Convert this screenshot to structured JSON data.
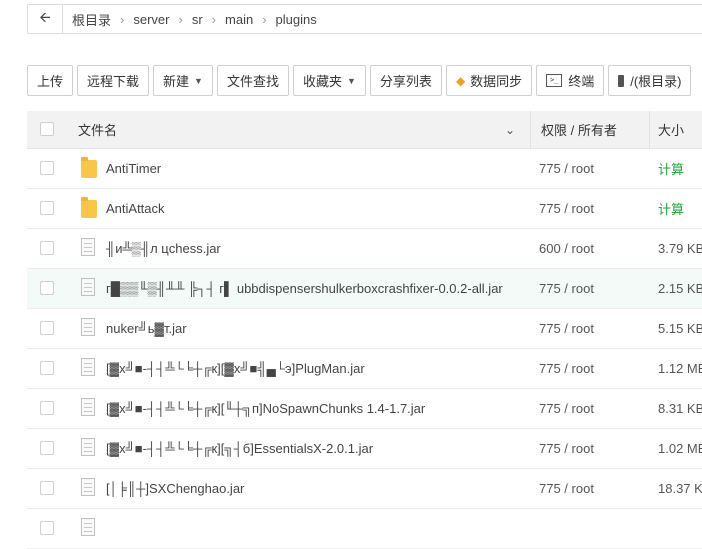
{
  "breadcrumb": {
    "back_icon": "arrow-left-icon",
    "items": [
      "根目录",
      "server",
      "sr",
      "main",
      "plugins"
    ]
  },
  "toolbar": {
    "upload": "上传",
    "remote_download": "远程下载",
    "new": "新建",
    "file_search": "文件查找",
    "favorites": "收藏夹",
    "share_list": "分享列表",
    "data_sync": "数据同步",
    "terminal": "终端",
    "root_path": "/(根目录)"
  },
  "table": {
    "headers": {
      "name": "文件名",
      "perm": "权限 / 所有者",
      "size": "大小"
    },
    "rows": [
      {
        "type": "folder",
        "name": "AntiTimer",
        "perm": "775 / root",
        "size": "计算"
      },
      {
        "type": "folder",
        "name": "AntiAttack",
        "perm": "775 / root",
        "size": "计算"
      },
      {
        "type": "file",
        "name": "╢и╩▒╢л цchess.jar",
        "perm": "600 / root",
        "size": "3.79 KB"
      },
      {
        "type": "file",
        "name": "г█▒▒╙▒╢╨╨ ╠┐┤ г▌ ubbdispensershulkerboxcrashfixer-0.0.2-all.jar",
        "perm": "775 / root",
        "size": "2.15 KB"
      },
      {
        "type": "file",
        "name": "nuker╝ь▓т.jar",
        "perm": "775 / root",
        "size": "5.15 KB"
      },
      {
        "type": "file",
        "name": "[▓х╝■-┤┤╩└╘┼╔к][▓х╝■╣▄└э]PlugMan.jar",
        "perm": "775 / root",
        "size": "1.12 MB"
      },
      {
        "type": "file",
        "name": "[▓х╝■-┤┤╩└╘┼╔к][╙┼╗п]NoSpawnChunks 1.4-1.7.jar",
        "perm": "775 / root",
        "size": "8.31 KB"
      },
      {
        "type": "file",
        "name": "[▓х╝■-┤┤╩└╘┼╔к][╗┤б]EssentialsX-2.0.1.jar",
        "perm": "775 / root",
        "size": "1.02 MB"
      },
      {
        "type": "file",
        "name": "[│╞║┼]SXChenghao.jar",
        "perm": "775 / root",
        "size": "18.37 KB"
      }
    ]
  }
}
